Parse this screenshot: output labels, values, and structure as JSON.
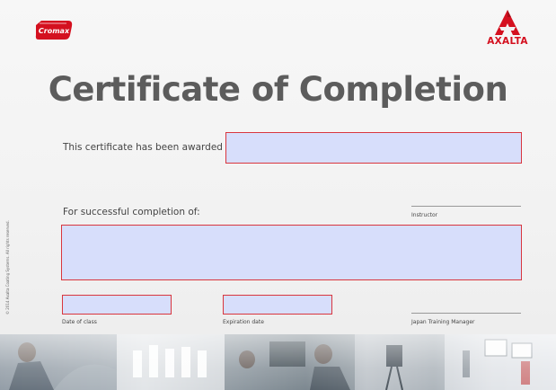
{
  "logos": {
    "left_brand": "Cromax",
    "right_brand": "AXALTA"
  },
  "title": "Certificate of Completion",
  "labels": {
    "awarded_to": "This certificate has been awarded to:",
    "completion_of": "For successful completion of:",
    "instructor": "Instructor",
    "date_of_class": "Date of class",
    "expiration_date": "Expiration date",
    "training_manager": "Japan Training Manager"
  },
  "fields": {
    "recipient_name": "",
    "course_name": "",
    "date_of_class": "",
    "expiration_date": ""
  },
  "copyright": "© 2014 Axalta Coating Systems. All rights reserved.",
  "colors": {
    "accent": "#d4101f",
    "field_fill": "#d7defb",
    "title": "#5c5c5c"
  }
}
